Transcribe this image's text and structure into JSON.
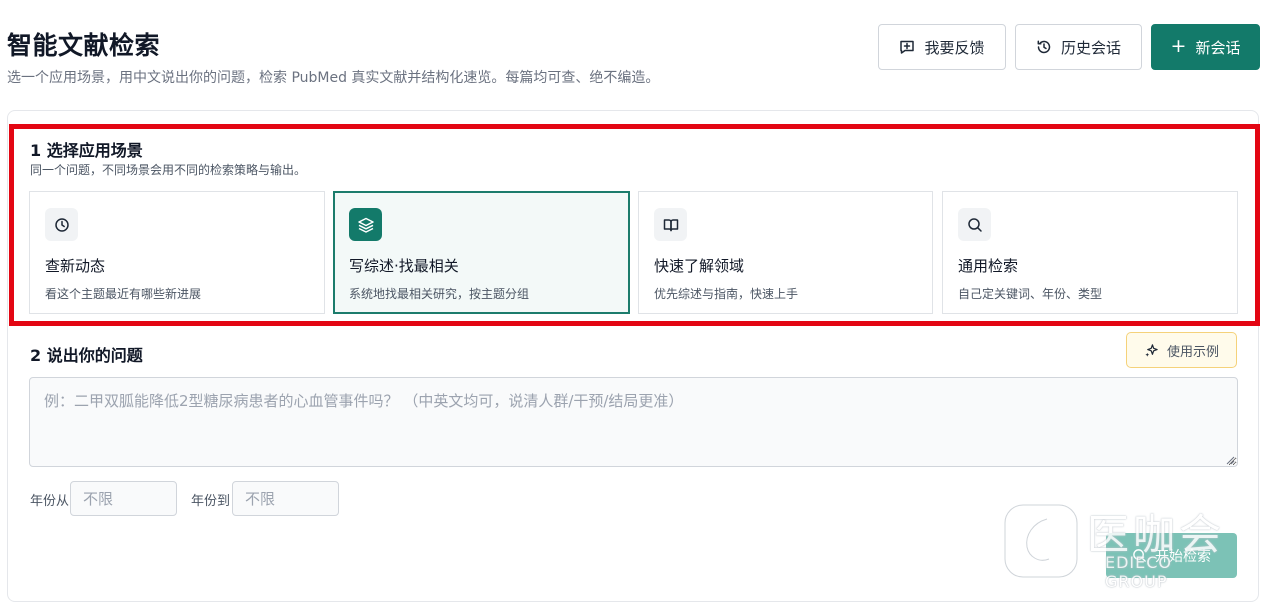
{
  "header": {
    "title": "智能文献检索",
    "subtitle": "选一个应用场景，用中文说出你的问题，检索 PubMed 真实文献并结构化速览。每篇均可查、绝不编造。",
    "buttons": {
      "feedback": "我要反馈",
      "history": "历史会话",
      "new_session": "新会话"
    }
  },
  "section1": {
    "title": "1 选择应用场景",
    "subtitle": "同一个问题，不同场景会用不同的检索策略与输出。",
    "cards": [
      {
        "icon": "clock-icon",
        "title": "查新动态",
        "desc": "看这个主题最近有哪些新进展",
        "selected": false
      },
      {
        "icon": "layers-icon",
        "title": "写综述·找最相关",
        "desc": "系统地找最相关研究，按主题分组",
        "selected": true
      },
      {
        "icon": "book-open-icon",
        "title": "快速了解领域",
        "desc": "优先综述与指南，快速上手",
        "selected": false
      },
      {
        "icon": "search-icon",
        "title": "通用检索",
        "desc": "自己定关键词、年份、类型",
        "selected": false
      }
    ]
  },
  "section2": {
    "title": "2 说出你的问题",
    "example_button": "使用示例",
    "question_placeholder": "例：二甲双胍能降低2型糖尿病患者的心血管事件吗？ （中英文均可，说清人群/干预/结局更准）",
    "question_value": "",
    "year_from_label": "年份从",
    "year_from_placeholder": "不限",
    "year_to_label": "年份到",
    "year_to_placeholder": "不限",
    "search_button": "开始检索"
  },
  "watermark": {
    "text": "医咖会",
    "sub": "EDIECO GROUP"
  },
  "colors": {
    "primary": "#137a6a",
    "primary_light": "#7cc2b6",
    "highlight_border": "#e30613",
    "example_bg": "#fffbeb",
    "example_border": "#f5d27a"
  }
}
